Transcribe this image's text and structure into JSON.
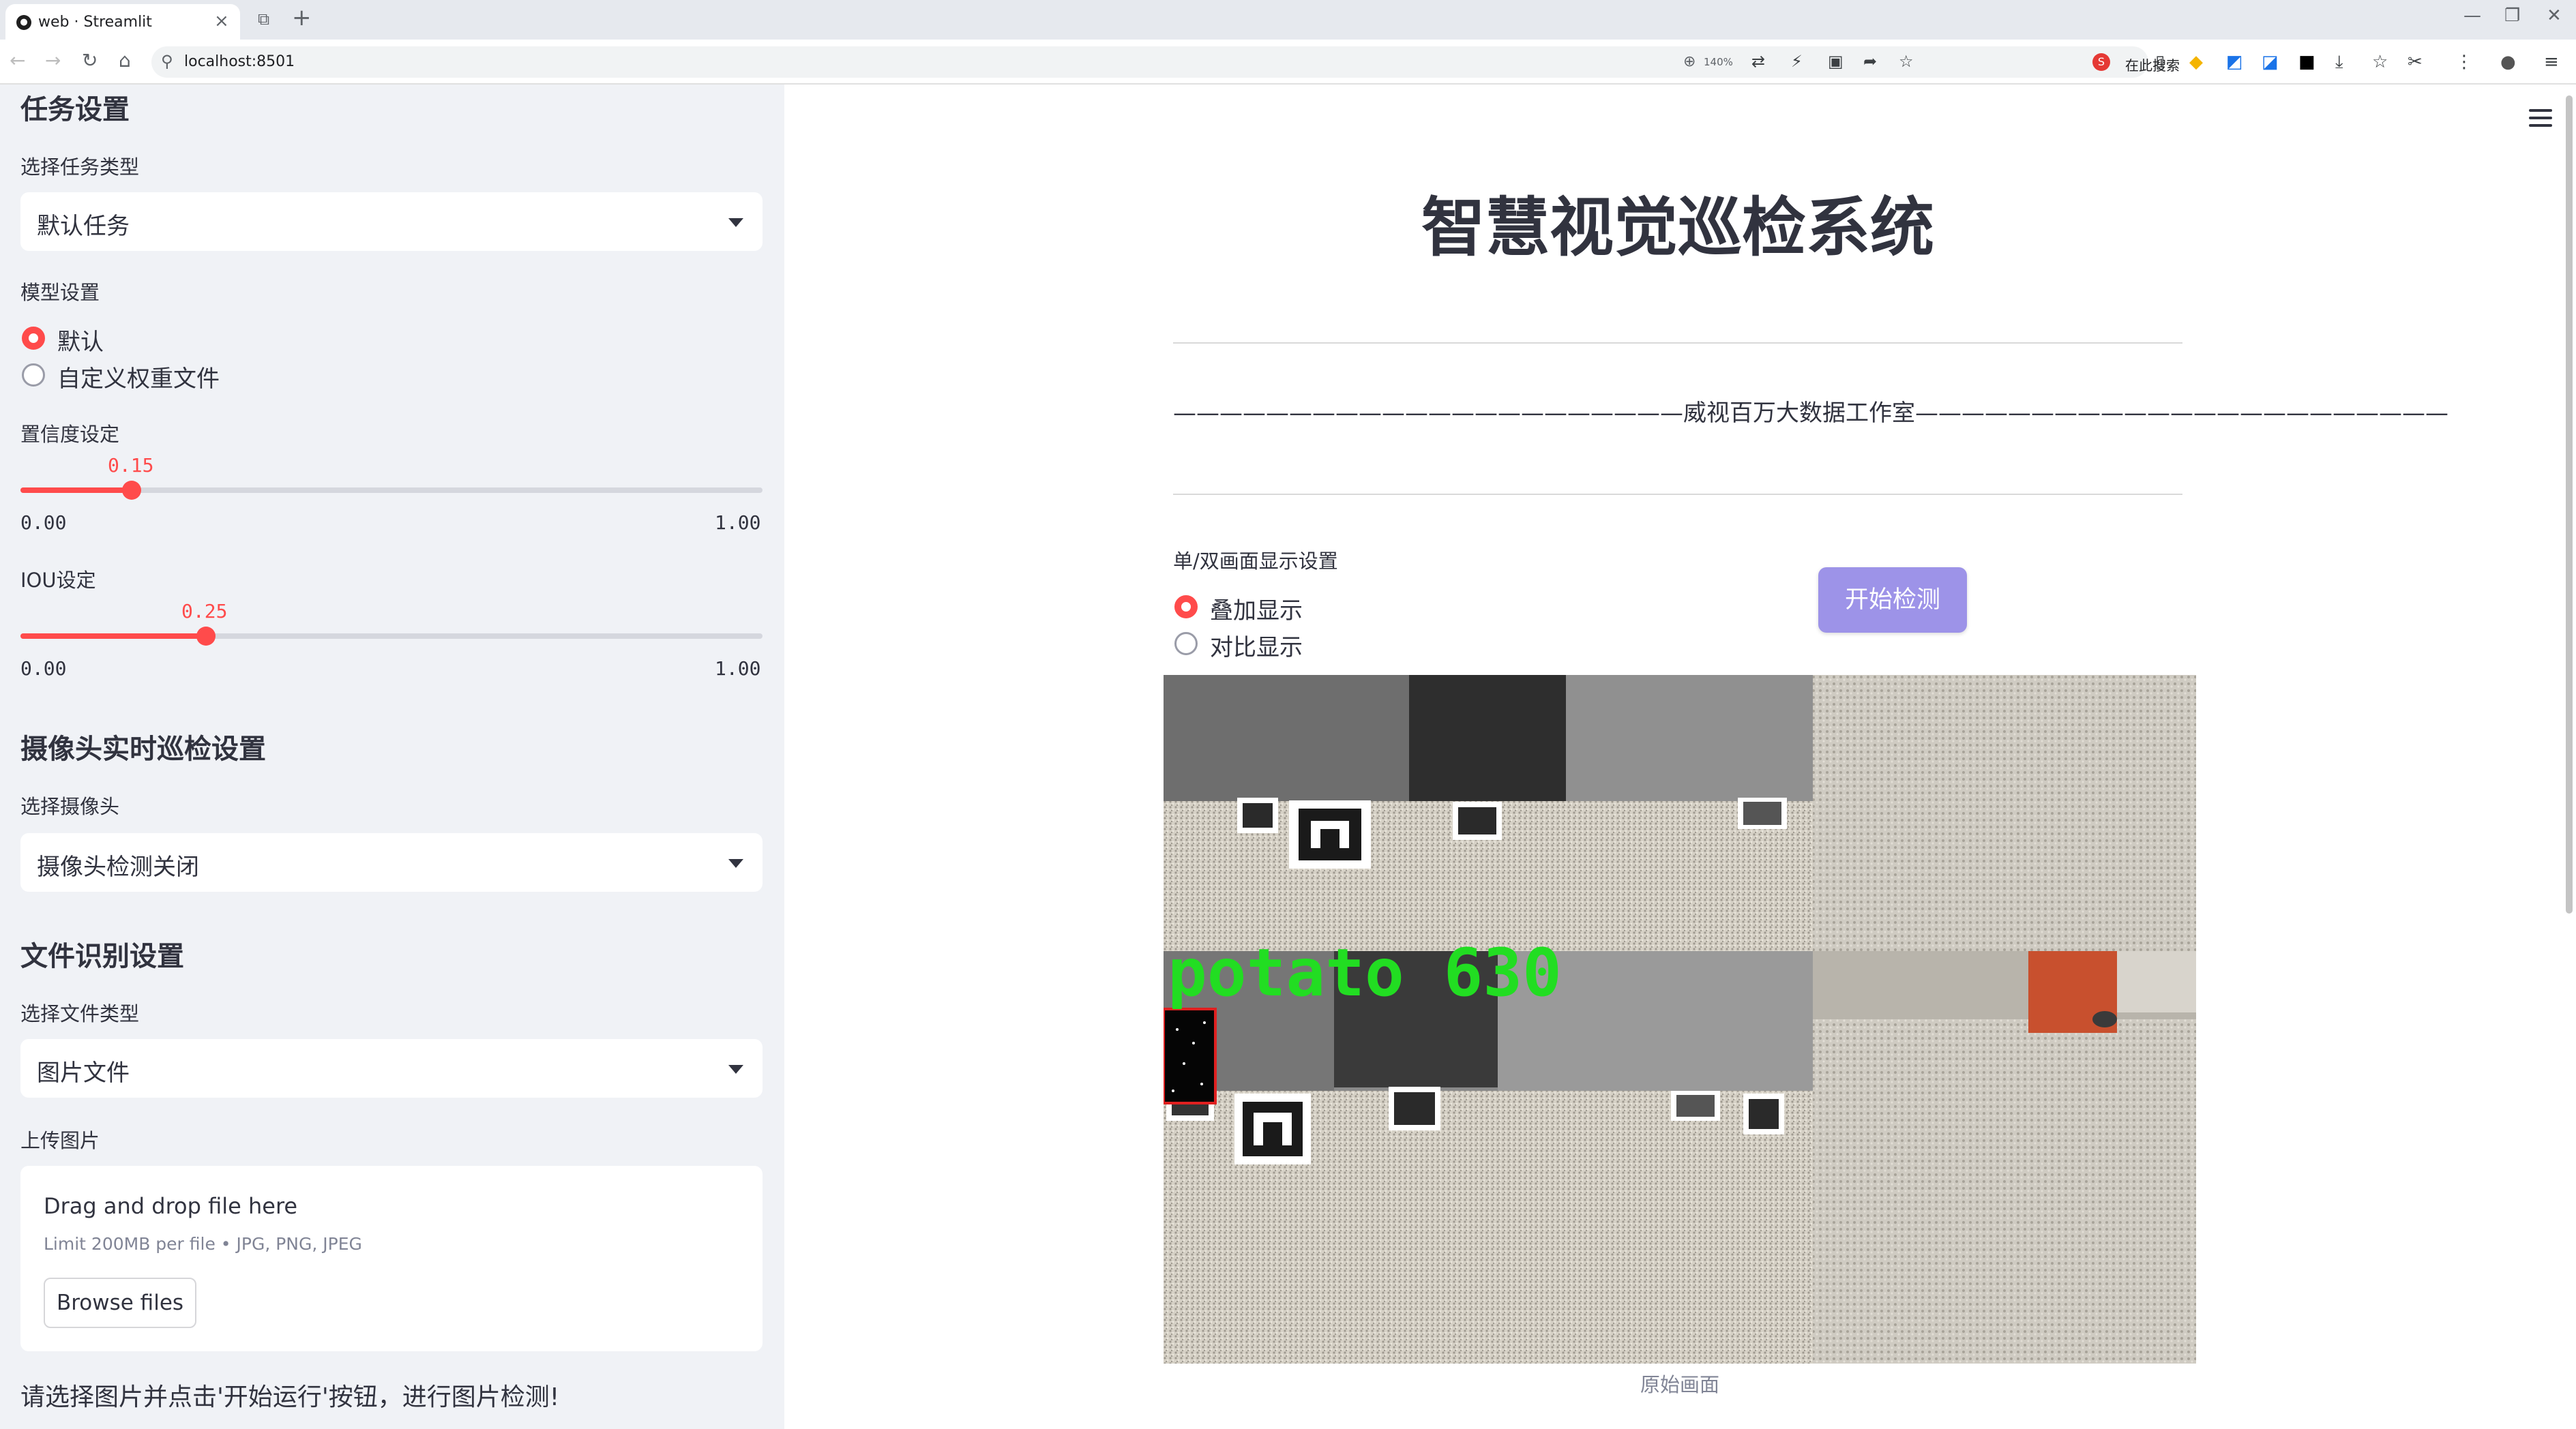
{
  "browser": {
    "tab_title": "web · Streamlit",
    "url": "localhost:8501",
    "zoom": "140%",
    "search_placeholder": "在此搜索"
  },
  "sidebar": {
    "task_header": "任务设置",
    "task_type_label": "选择任务类型",
    "task_type_value": "默认任务",
    "model_label": "模型设置",
    "model_options": [
      "默认",
      "自定义权重文件"
    ],
    "model_selected": "默认",
    "confidence_label": "置信度设定",
    "confidence_value": "0.15",
    "confidence_level": 0.15,
    "confidence_min": "0.00",
    "confidence_max": "1.00",
    "iou_label": "IOU设定",
    "iou_value": "0.25",
    "iou_level": 0.25,
    "iou_min": "0.00",
    "iou_max": "1.00",
    "camera_header": "摄像头实时巡检设置",
    "camera_label": "选择摄像头",
    "camera_value": "摄像头检测关闭",
    "file_header": "文件识别设置",
    "file_type_label": "选择文件类型",
    "file_type_value": "图片文件",
    "upload_label": "上传图片",
    "upload_title": "Drag and drop file here",
    "upload_limit": "Limit 200MB per file • JPG, PNG, JPEG",
    "browse_button": "Browse files",
    "note": "请选择图片并点击'开始运行'按钮，进行图片检测!"
  },
  "main": {
    "title": "智慧视觉巡检系统",
    "subtitle": "——————————————————————威视百万大数据工作室———————————————————————",
    "display_label": "单/双画面显示设置",
    "display_options": [
      "叠加显示",
      "对比显示"
    ],
    "display_selected": "叠加显示",
    "start_button": "开始检测",
    "detection_label": "potato 630",
    "image_caption": "原始画面"
  },
  "colors": {
    "accent": "#ff4b4b",
    "button": "#9d93e8",
    "sidebar_bg": "#f0f2f6",
    "detection_text": "#22dd22"
  }
}
